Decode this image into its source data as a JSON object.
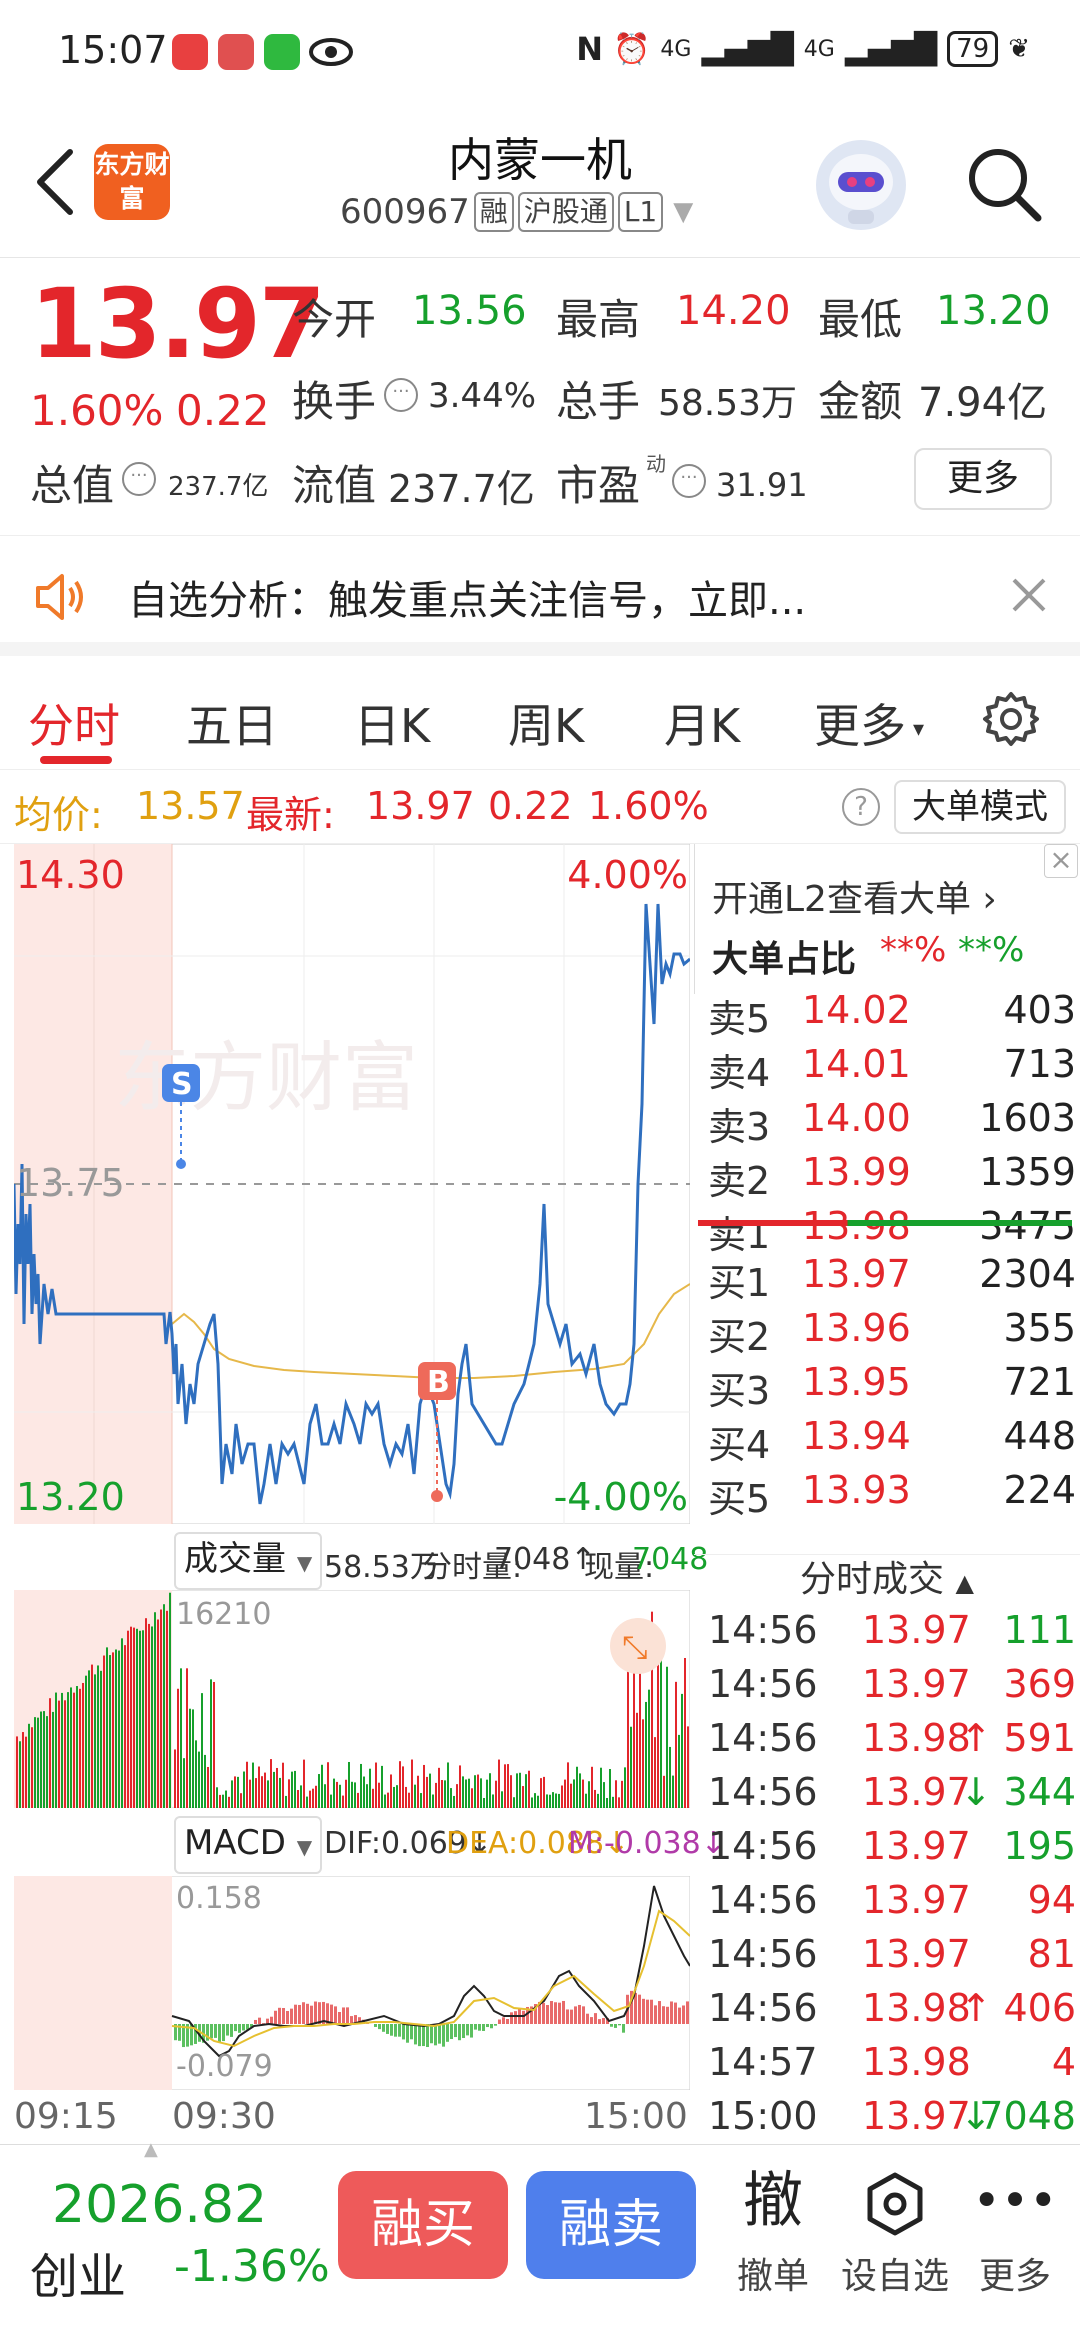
{
  "status": {
    "time": "15:07",
    "signal1": "4G",
    "signal2": "4G",
    "battery": "79"
  },
  "header": {
    "logo_text": "东方财富",
    "title": "内蒙一机",
    "code": "600967",
    "tags": [
      "融",
      "沪股通",
      "L1"
    ]
  },
  "quote": {
    "price": "13.97",
    "pct": "1.60%",
    "chg": "0.22",
    "open_label": "今开",
    "open": "13.56",
    "high_label": "最高",
    "high": "14.20",
    "low_label": "最低",
    "low": "13.20",
    "turnover_label": "换手",
    "turnover": "3.44%",
    "volume_label": "总手",
    "volume": "58.53万",
    "amount_label": "金额",
    "amount": "7.94亿",
    "mcap_label": "总值",
    "mcap": "237.7亿",
    "float_label": "流值",
    "float": "237.7亿",
    "pe_label": "市盈",
    "pe_sup": "动",
    "pe": "31.91",
    "more_button": "更多"
  },
  "notice": {
    "text": "自选分析：触发重点关注信号，立即..."
  },
  "tabs": [
    "分时",
    "五日",
    "日K",
    "周K",
    "月K",
    "更多"
  ],
  "info_row": {
    "avg_label": "均价:",
    "avg": "13.57",
    "latest_label": "最新:",
    "latest": "13.97",
    "latest_chg": "0.22",
    "latest_pct": "1.60%",
    "help": "?",
    "big_mode": "大单模式"
  },
  "chart": {
    "price_top": "14.30",
    "price_mid": "13.75",
    "price_bottom": "13.20",
    "pct_top": "4.00%",
    "pct_bottom": "-4.00%",
    "watermark": "东方财富",
    "marker_s": "S",
    "marker_b": "B",
    "vol_select": "成交量",
    "vol_total": "58.53万",
    "vol_period_label": "分时量:",
    "vol_period": "7048",
    "vol_now_label": "现量:",
    "vol_now": "7048",
    "vol_max": "16210",
    "macd_select": "MACD",
    "dif": "DIF:0.069",
    "dea": "DEA:0.088",
    "m": "M:-0.038",
    "macd_top": "0.158",
    "macd_bottom": "-0.079",
    "times": [
      "09:15",
      "09:30",
      "15:00"
    ]
  },
  "orderbook": {
    "promo": "开通L2查看大单",
    "big_ratio_label": "大单占比",
    "big_ratio_a": "**%",
    "big_ratio_b": "**%",
    "asks": [
      {
        "label": "卖5",
        "price": "14.02",
        "vol": "403"
      },
      {
        "label": "卖4",
        "price": "14.01",
        "vol": "713"
      },
      {
        "label": "卖3",
        "price": "14.00",
        "vol": "1603"
      },
      {
        "label": "卖2",
        "price": "13.99",
        "vol": "1359"
      },
      {
        "label": "卖1",
        "price": "13.98",
        "vol": "3475"
      }
    ],
    "bids": [
      {
        "label": "买1",
        "price": "13.97",
        "vol": "2304"
      },
      {
        "label": "买2",
        "price": "13.96",
        "vol": "355"
      },
      {
        "label": "买3",
        "price": "13.95",
        "vol": "721"
      },
      {
        "label": "买4",
        "price": "13.94",
        "vol": "448"
      },
      {
        "label": "买5",
        "price": "13.93",
        "vol": "224"
      }
    ],
    "trades_title": "分时成交",
    "trades": [
      {
        "time": "14:56",
        "price": "13.97",
        "arrow": "",
        "vol": "111",
        "dir": "green"
      },
      {
        "time": "14:56",
        "price": "13.97",
        "arrow": "",
        "vol": "369",
        "dir": "red"
      },
      {
        "time": "14:56",
        "price": "13.98",
        "arrow": "↑",
        "vol": "591",
        "dir": "red"
      },
      {
        "time": "14:56",
        "price": "13.97",
        "arrow": "↓",
        "vol": "344",
        "dir": "green"
      },
      {
        "time": "14:56",
        "price": "13.97",
        "arrow": "",
        "vol": "195",
        "dir": "green"
      },
      {
        "time": "14:56",
        "price": "13.97",
        "arrow": "",
        "vol": "94",
        "dir": "red"
      },
      {
        "time": "14:56",
        "price": "13.97",
        "arrow": "",
        "vol": "81",
        "dir": "red"
      },
      {
        "time": "14:56",
        "price": "13.98",
        "arrow": "↑",
        "vol": "406",
        "dir": "red"
      },
      {
        "time": "14:57",
        "price": "13.98",
        "arrow": "",
        "vol": "4",
        "dir": "red"
      },
      {
        "time": "15:00",
        "price": "13.97",
        "arrow": "↓",
        "vol": "7048",
        "dir": "green"
      }
    ]
  },
  "bottom": {
    "index_value": "2026.82",
    "index_name": "创业",
    "index_chg": "-1.36%",
    "buy": "融买",
    "sell": "融卖",
    "cancel_icon": "撤",
    "cancel_label": "撤单",
    "watch_label": "设自选",
    "more_label": "更多"
  }
}
